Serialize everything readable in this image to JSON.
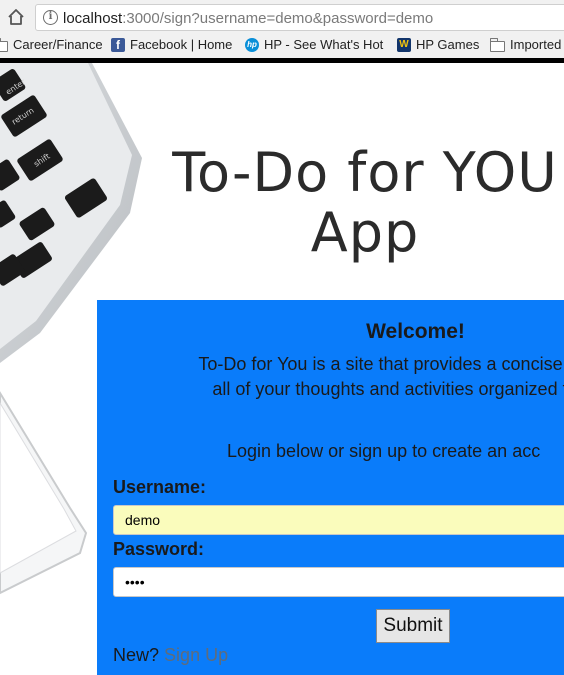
{
  "browser": {
    "url_host": "localhost",
    "url_rest": ":3000/sign?username=demo&password=demo",
    "bookmarks": [
      {
        "label": "Career/Finance",
        "icon": "folder-icon"
      },
      {
        "label": "Facebook | Home",
        "icon": "facebook-icon"
      },
      {
        "label": "HP - See What's Hot",
        "icon": "hp-icon"
      },
      {
        "label": "HP Games",
        "icon": "hp-games-icon"
      },
      {
        "label": "Imported",
        "icon": "folder-icon"
      }
    ]
  },
  "hero": {
    "title_line1": "To-Do for YOU",
    "title_line2": "App"
  },
  "panel": {
    "welcome": "Welcome!",
    "desc_line1": "To-Do for You is a site that provides a concise and cre",
    "desc_line2": "all of your thoughts and activities organized throug",
    "login_hint": "Login below or sign up to create an acc",
    "username_label": "Username:",
    "username_value": "demo",
    "password_label": "Password:",
    "password_value": "demo",
    "submit_label": "Submit",
    "new_label": "New?",
    "signup_label": "Sign Up"
  },
  "colors": {
    "panel_bg": "#0a7cfa",
    "autofill_bg": "#fafcbc",
    "link": "#5f6c7b"
  }
}
